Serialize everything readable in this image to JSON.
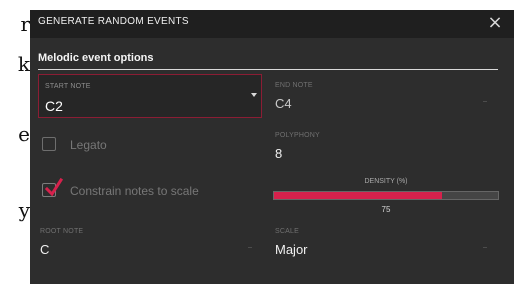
{
  "background": {
    "left_text": [
      "r",
      "k",
      "e",
      "y"
    ]
  },
  "dialog": {
    "title": "GENERATE RANDOM EVENTS",
    "close_icon": "close-icon",
    "section_title": "Melodic event options",
    "fields": {
      "start_note": {
        "label": "START NOTE",
        "value": "C2"
      },
      "end_note": {
        "label": "END NOTE",
        "value": "C4"
      },
      "polyphony": {
        "label": "POLYPHONY",
        "value": "8"
      },
      "root_note": {
        "label": "ROOT NOTE",
        "value": "C"
      },
      "scale": {
        "label": "SCALE",
        "value": "Major"
      }
    },
    "checkboxes": {
      "legato": {
        "label": "Legato",
        "checked": false
      },
      "constrain": {
        "label": "Constrain notes to scale",
        "checked": true
      }
    },
    "density": {
      "label": "DENSITY (%)",
      "value": "75",
      "percent": 75
    }
  },
  "colors": {
    "accent": "#d6214c",
    "dialog_bg": "#2d2d2d",
    "header_bg": "#1f1f1f",
    "selected_border": "#8b1d34"
  }
}
